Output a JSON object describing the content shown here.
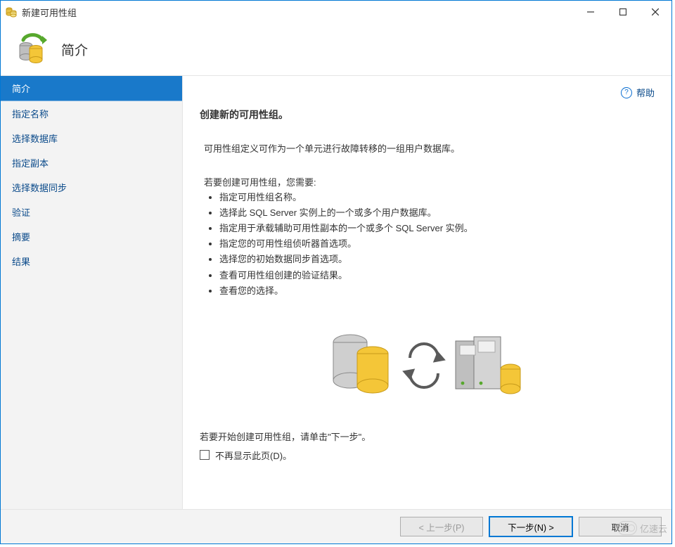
{
  "window": {
    "title": "新建可用性组"
  },
  "header": {
    "title": "简介"
  },
  "sidebar": {
    "items": [
      {
        "label": "简介",
        "selected": true
      },
      {
        "label": "指定名称",
        "selected": false
      },
      {
        "label": "选择数据库",
        "selected": false
      },
      {
        "label": "指定副本",
        "selected": false
      },
      {
        "label": "选择数据同步",
        "selected": false
      },
      {
        "label": "验证",
        "selected": false
      },
      {
        "label": "摘要",
        "selected": false
      },
      {
        "label": "结果",
        "selected": false
      }
    ]
  },
  "content": {
    "help_label": "帮助",
    "heading": "创建新的可用性组。",
    "definition": "可用性组定义可作为一个单元进行故障转移的一组用户数据库。",
    "need_title": "若要创建可用性组，您需要:",
    "bullets": [
      "指定可用性组名称。",
      "选择此 SQL Server 实例上的一个或多个用户数据库。",
      "指定用于承载辅助可用性副本的一个或多个 SQL Server 实例。",
      "指定您的可用性组侦听器首选项。",
      "选择您的初始数据同步首选项。",
      "查看可用性组创建的验证结果。",
      "查看您的选择。"
    ],
    "start_line": "若要开始创建可用性组，请单击\"下一步\"。",
    "dont_show_label": "不再显示此页(D)。"
  },
  "footer": {
    "prev": "< 上一步(P)",
    "next": "下一步(N) >",
    "cancel": "取消"
  },
  "watermark": {
    "text": "亿速云"
  }
}
